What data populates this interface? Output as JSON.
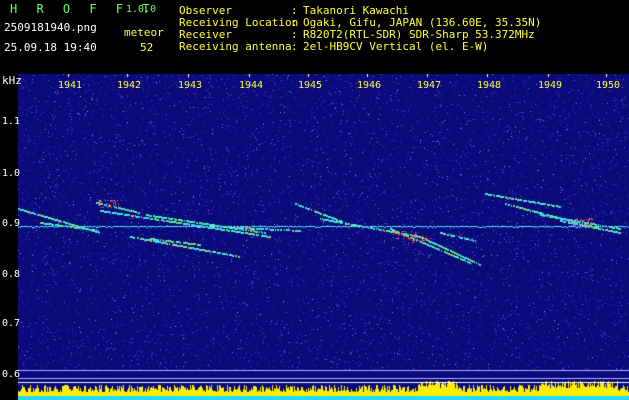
{
  "header": {
    "brand": "H R O F F T",
    "version": "1.0.0",
    "filename": "2509181940.png",
    "timestamp": "25.09.18 19:40",
    "meteor_label": "meteor",
    "meteor_count": "52",
    "info": [
      {
        "label": "Observer",
        "value": "Takanori Kawachi"
      },
      {
        "label": "Receiving Location",
        "value": "Ogaki, Gifu, JAPAN (136.60E, 35.35N)"
      },
      {
        "label": "Receiver",
        "value": "R820T2(RTL-SDR) SDR-Sharp 53.372MHz"
      },
      {
        "label": "Receiving antenna",
        "value": "2el-HB9CV Vertical (el. E-W)"
      }
    ]
  },
  "spectrogram": {
    "y_unit": "kHz",
    "y_ticks": [
      "1.1",
      "1.0",
      "0.9",
      "0.8",
      "0.7",
      "0.6"
    ],
    "x_ticks": [
      "1941",
      "1942",
      "1943",
      "1944",
      "1945",
      "1946",
      "1947",
      "1948",
      "1949",
      "1950"
    ],
    "colors": {
      "background": "#0a0a7a",
      "noise": "#3a3acc",
      "echo": "#33d6ff",
      "echo_hot": "#ff8833",
      "baseline": "#ffee00",
      "baseline_low": "#22d8ff"
    }
  }
}
